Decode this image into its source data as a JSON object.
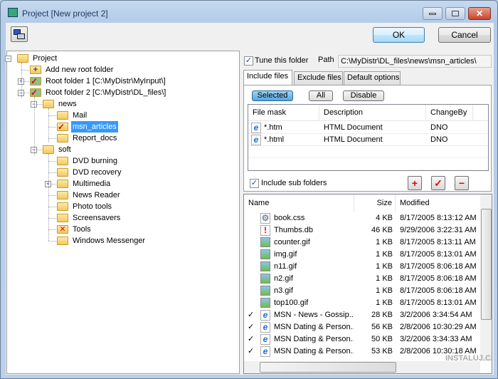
{
  "window": {
    "title": "Project [New project 2]",
    "ok_label": "OK",
    "cancel_label": "Cancel"
  },
  "tree": [
    {
      "label": "Project",
      "level": 0,
      "expander": "minus",
      "icon": "folder-icon"
    },
    {
      "label": "Add new root folder",
      "level": 1,
      "icon": "add-folder-icon"
    },
    {
      "label": "Root folder 1 [C:\\MyDistr\\MyInput\\]",
      "level": 1,
      "expander": "plus",
      "icon": "root-folder-check-icon"
    },
    {
      "label": "Root folder 2 [C:\\MyDistr\\DL_files\\]",
      "level": 1,
      "expander": "minus",
      "icon": "root-folder-check-icon"
    },
    {
      "label": "news",
      "level": 2,
      "expander": "minus",
      "icon": "folder-icon"
    },
    {
      "label": "Mail",
      "level": 3,
      "icon": "folder-icon"
    },
    {
      "label": "msn_articles",
      "level": 3,
      "icon": "folder-check-icon",
      "selected": true
    },
    {
      "label": "Report_docs",
      "level": 3,
      "icon": "folder-icon"
    },
    {
      "label": "soft",
      "level": 2,
      "expander": "minus",
      "icon": "folder-icon"
    },
    {
      "label": "DVD burning",
      "level": 3,
      "icon": "folder-icon"
    },
    {
      "label": "DVD recovery",
      "level": 3,
      "icon": "folder-icon"
    },
    {
      "label": "Multimedia",
      "level": 3,
      "expander": "plus",
      "icon": "folder-icon"
    },
    {
      "label": "News Reader",
      "level": 3,
      "icon": "folder-icon"
    },
    {
      "label": "Photo tools",
      "level": 3,
      "icon": "folder-icon"
    },
    {
      "label": "Screensavers",
      "level": 3,
      "icon": "folder-icon"
    },
    {
      "label": "Tools",
      "level": 3,
      "icon": "folder-excluded-icon"
    },
    {
      "label": "Windows Messenger",
      "level": 3,
      "icon": "folder-icon"
    }
  ],
  "settings": {
    "tune_label": "Tune this folder",
    "tune_checked": true,
    "path_label": "Path",
    "path_value": "C:\\MyDistr\\DL_files\\news\\msn_articles\\",
    "tabs": [
      "Include files",
      "Exclude files",
      "Default options"
    ],
    "active_tab": "Include files",
    "modes": [
      "Selected",
      "All",
      "Disable"
    ],
    "active_mode": "Selected",
    "mask_headers": [
      "File mask",
      "Description",
      "ChangeBy"
    ],
    "masks": [
      [
        "*.htm",
        "HTML Document",
        "DNO"
      ],
      [
        "*.html",
        "HTML Document",
        "DNO"
      ]
    ],
    "subfolders_label": "Include sub folders",
    "subfolders_checked": true
  },
  "files": {
    "headers": [
      "Name",
      "Size",
      "Modified"
    ],
    "rows": [
      {
        "check": false,
        "icon": "css-file-icon",
        "name": "book.css",
        "size": "4 KB",
        "modified": "8/17/2005 8:13:12 AM"
      },
      {
        "check": false,
        "icon": "db-file-icon",
        "name": "Thumbs.db",
        "size": "46 KB",
        "modified": "9/29/2006 3:22:31 AM"
      },
      {
        "check": false,
        "icon": "image-file-icon",
        "name": "counter.gif",
        "size": "1 KB",
        "modified": "8/17/2005 8:13:11 AM"
      },
      {
        "check": false,
        "icon": "image-file-icon",
        "name": "img.gif",
        "size": "1 KB",
        "modified": "8/17/2005 8:13:01 AM"
      },
      {
        "check": false,
        "icon": "image-file-icon",
        "name": "n11.gif",
        "size": "1 KB",
        "modified": "8/17/2005 8:06:18 AM"
      },
      {
        "check": false,
        "icon": "image-file-icon",
        "name": "n2.gif",
        "size": "1 KB",
        "modified": "8/17/2005 8:06:18 AM"
      },
      {
        "check": false,
        "icon": "image-file-icon",
        "name": "n3.gif",
        "size": "1 KB",
        "modified": "8/17/2005 8:06:18 AM"
      },
      {
        "check": false,
        "icon": "image-file-icon",
        "name": "top100.gif",
        "size": "1 KB",
        "modified": "8/17/2005 8:13:01 AM"
      },
      {
        "check": true,
        "icon": "html-file-icon",
        "name": "MSN - News - Gossip...",
        "size": "28 KB",
        "modified": "3/2/2006 3:34:54 AM"
      },
      {
        "check": true,
        "icon": "html-file-icon",
        "name": "MSN Dating & Person...",
        "size": "56 KB",
        "modified": "2/8/2006 10:30:29 AM"
      },
      {
        "check": true,
        "icon": "html-file-icon",
        "name": "MSN Dating & Person...",
        "size": "50 KB",
        "modified": "3/2/2006 3:34:33 AM"
      },
      {
        "check": true,
        "icon": "html-file-icon",
        "name": "MSN Dating & Person...",
        "size": "53 KB",
        "modified": "2/8/2006 10:30:18 AM"
      }
    ]
  },
  "watermark": "INSTALUJ.CZ"
}
